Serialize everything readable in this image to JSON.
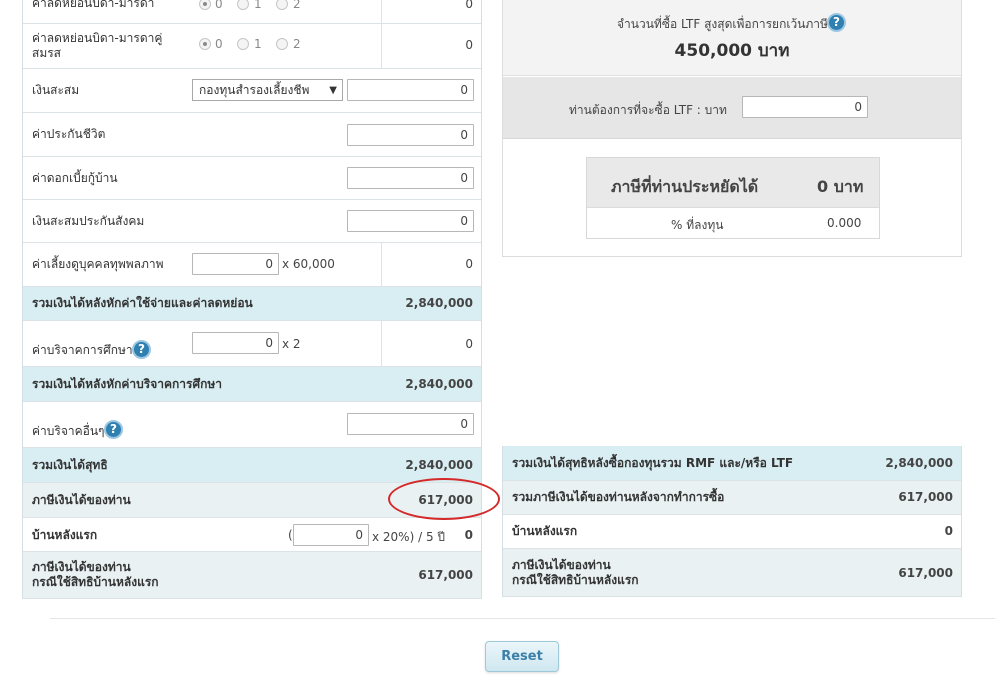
{
  "left": {
    "parent_deduction": {
      "label": "ค่าลดหย่อนบิดา-มารดา",
      "options": [
        "0",
        "1",
        "2"
      ],
      "value": "0"
    },
    "spouse_parent_deduction": {
      "label": "ค่าลดหย่อนบิดา-มารดาคู่สมรส",
      "options": [
        "0",
        "1",
        "2"
      ],
      "value": "0"
    },
    "savings": {
      "label": "เงินสะสม",
      "fund_select": "กองทุนสำรองเลี้ยงชีพ",
      "input": "0"
    },
    "life_insurance": {
      "label": "ค่าประกันชีวิต",
      "input": "0"
    },
    "home_interest": {
      "label": "ค่าดอกเบี้ยกู้บ้าน",
      "input": "0"
    },
    "social_security": {
      "label": "เงินสะสมประกันสังคม",
      "input": "0"
    },
    "disabled_care": {
      "label": "ค่าเลี้ยงดูบุคคลทุพพลภาพ",
      "input": "0",
      "multiplier": "x 60,000",
      "value": "0"
    },
    "sum_after_expenses": {
      "label": "รวมเงินได้หลังหักค่าใช้จ่ายและค่าลดหย่อน",
      "value": "2,840,000"
    },
    "education_donation": {
      "label": "ค่าบริจาคการศึกษา",
      "input": "0",
      "multiplier": "x 2",
      "value": "0"
    },
    "sum_after_education": {
      "label": "รวมเงินได้หลังหักค่าบริจาคการศึกษา",
      "value": "2,840,000"
    },
    "other_donation": {
      "label": "ค่าบริจาคอื่นๆ",
      "input": "0"
    },
    "net_income": {
      "label": "รวมเงินได้สุทธิ",
      "value": "2,840,000"
    },
    "your_tax": {
      "label": "ภาษีเงินได้ของท่าน",
      "value": "617,000"
    },
    "first_home": {
      "label": "บ้านหลังแรก",
      "open_paren": "(",
      "input": "0",
      "formula": "x 20%) / 5 ปี",
      "value": "0"
    },
    "tax_first_home": {
      "label_line1": "ภาษีเงินได้ของท่าน",
      "label_line2": "กรณีใช้สิทธิบ้านหลังแรก",
      "value": "617,000"
    }
  },
  "right": {
    "max_ltf_label": "จำนวนที่ซื้อ LTF สูงสุดเพื่อการยกเว้นภาษี",
    "max_ltf_value": "450,000 บาท",
    "buy_ltf_label": "ท่านต้องการที่จะซื้อ LTF : บาท",
    "buy_ltf_input": "0",
    "tax_saved_label": "ภาษีที่ท่านประหยัดได้",
    "tax_saved_value": "0 บาท",
    "percent_label": "% ที่ลงทุน",
    "percent_value": "0.000",
    "net_after_funds": {
      "label": "รวมเงินได้สุทธิหลังซื้อกองทุนรวม RMF และ/หรือ LTF",
      "value": "2,840,000"
    },
    "tax_after_purchase": {
      "label": "รวมภาษีเงินได้ของท่านหลังจากทำการซื้อ",
      "value": "617,000"
    },
    "first_home": {
      "label": "บ้านหลังแรก",
      "value": "0"
    },
    "tax_first_home": {
      "label_line1": "ภาษีเงินได้ของท่าน",
      "label_line2": "กรณีใช้สิทธิบ้านหลังแรก",
      "value": "617,000"
    }
  },
  "reset_label": "Reset",
  "help_icon_char": "?",
  "colors": {
    "accent": "#2f7fb1",
    "sum_row": "#d9eef3",
    "annotation": "#d42a2a"
  }
}
